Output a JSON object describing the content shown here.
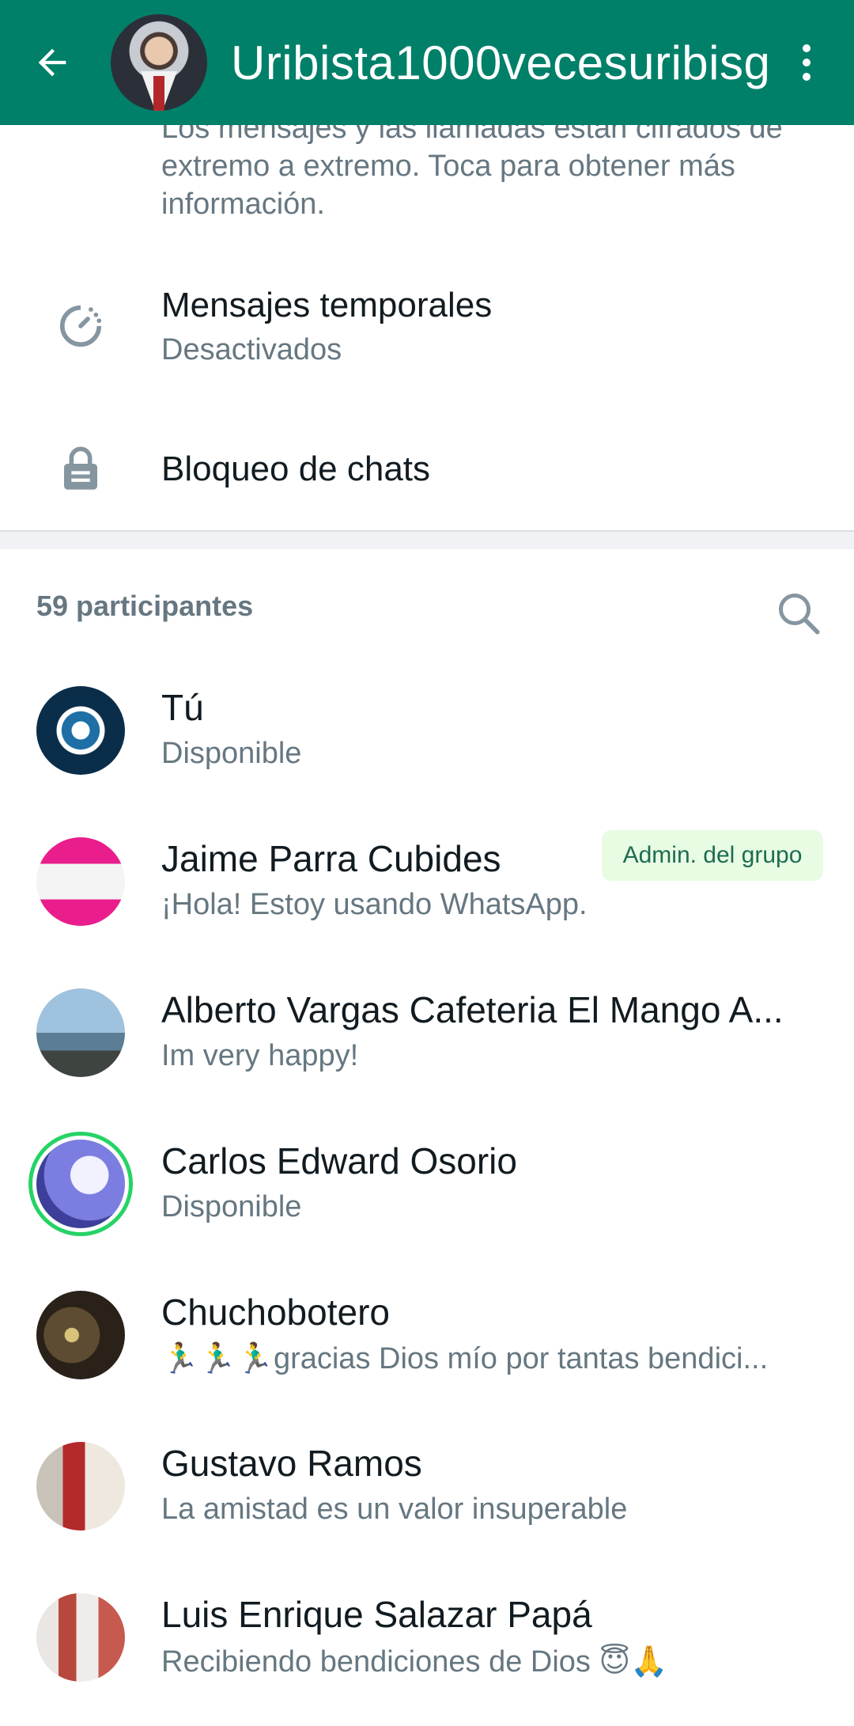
{
  "header": {
    "title": "Uribista1000vecesuribisg",
    "back_icon": "arrow-left-icon",
    "menu_icon": "more-vert-icon"
  },
  "encryption": {
    "text": "Los mensajes y las llamadas están cifrados de extremo a extremo. Toca para obtener más información."
  },
  "settings": [
    {
      "icon": "timer-icon",
      "title": "Mensajes temporales",
      "subtitle": "Desactivados"
    },
    {
      "icon": "lock-icon",
      "title": "Bloqueo de chats",
      "subtitle": ""
    }
  ],
  "participants": {
    "header": "59 participantes",
    "search_icon": "search-icon",
    "items": [
      {
        "name": "Tú",
        "status": "Disponible",
        "badge": ""
      },
      {
        "name": "Jaime Parra Cubides",
        "status": "¡Hola! Estoy usando WhatsApp.",
        "badge": "Admin. del grupo"
      },
      {
        "name": "Alberto Vargas Cafeteria El Mango A...",
        "status": "Im very happy!",
        "badge": ""
      },
      {
        "name": "Carlos Edward Osorio",
        "status": "Disponible",
        "badge": ""
      },
      {
        "name": "Chuchobotero",
        "status": "🏃‍♂️🏃‍♂️🏃‍♂️gracias Dios mío por tantas bendici...",
        "badge": ""
      },
      {
        "name": "Gustavo Ramos",
        "status": "La amistad es un valor insuperable",
        "badge": ""
      },
      {
        "name": "Luis Enrique Salazar Papá",
        "status": "Recibiendo bendiciones de Dios 😇🙏",
        "badge": ""
      }
    ]
  },
  "colors": {
    "header_bg": "#008069",
    "badge_bg": "#e7fce3",
    "status_ring": "#25d366"
  }
}
